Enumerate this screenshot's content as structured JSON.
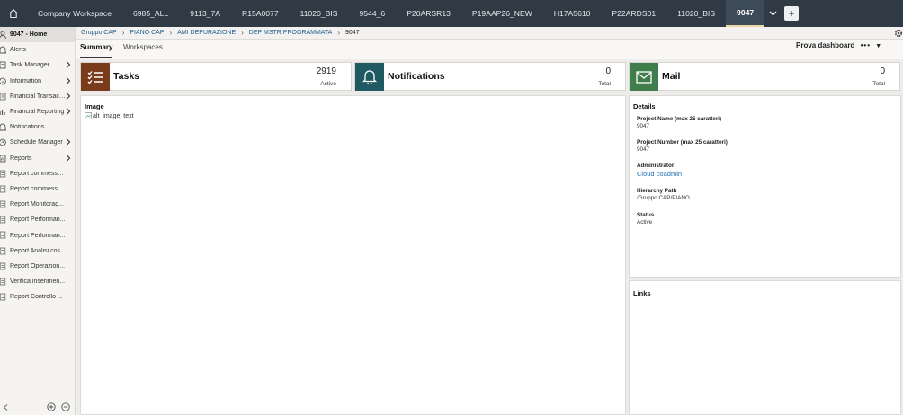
{
  "topbar": {
    "tabs": [
      "Company Workspace",
      "6985_ALL",
      "9113_7A",
      "R15A0077",
      "11020_BIS",
      "9544_6",
      "P20ARSR13",
      "P19AAP26_NEW",
      "H17A5610",
      "P22ARDS01",
      "11020_BIS",
      "9047"
    ],
    "add_label": "+"
  },
  "sidebar": {
    "items": [
      {
        "label": "9047 - Home",
        "chevron": false
      },
      {
        "label": "Alerts",
        "chevron": false
      },
      {
        "label": "Task Manager",
        "chevron": true
      },
      {
        "label": "Information",
        "chevron": true
      },
      {
        "label": "Financial Transacti...",
        "chevron": true
      },
      {
        "label": "Financial Reporting",
        "chevron": true
      },
      {
        "label": "Notifications",
        "chevron": false
      },
      {
        "label": "Schedule Manager",
        "chevron": true
      },
      {
        "label": "Reports",
        "chevron": true
      },
      {
        "label": "Report commesse...",
        "chevron": false
      },
      {
        "label": "Report commesse...",
        "chevron": false
      },
      {
        "label": "Report Monitorag...",
        "chevron": false
      },
      {
        "label": "Report Performan...",
        "chevron": false
      },
      {
        "label": "Report Performan...",
        "chevron": false
      },
      {
        "label": "Report Analisi cos...",
        "chevron": false
      },
      {
        "label": "Report Operazion...",
        "chevron": false
      },
      {
        "label": "Verifica inserimen...",
        "chevron": false
      },
      {
        "label": "Report Controllo ...",
        "chevron": false
      }
    ]
  },
  "breadcrumb": {
    "items": [
      "Gruppo CAP",
      "PIANO CAP",
      "AMI DEPURAZIONE",
      "DEP MSTR PROGRAMMATA"
    ],
    "current": "9047"
  },
  "subtabs": {
    "summary": "Summary",
    "workspaces": "Workspaces",
    "dashboard_label": "Prova dashboard"
  },
  "cards": {
    "tasks": {
      "title": "Tasks",
      "count": "2919",
      "sub": "Active",
      "color": "#7a3b1d"
    },
    "notifications": {
      "title": "Notifications",
      "count": "0",
      "sub": "Total",
      "color": "#1f5a63"
    },
    "mail": {
      "title": "Mail",
      "count": "0",
      "sub": "Total",
      "color": "#3f7d4a"
    }
  },
  "image_panel": {
    "title": "Image",
    "alt": "alt_image_text"
  },
  "details": {
    "title": "Details",
    "project_name_label": "Project Name (max 25 caratteri)",
    "project_name": "9047",
    "project_number_label": "Project Number (max 25 caratteri)",
    "project_number": "9047",
    "administrator_label": "Administrator",
    "administrator": "Cloud coadmin",
    "hierarchy_label": "Hierarchy Path",
    "hierarchy": "/Gruppo CAP/PIANO ...",
    "status_label": "Status",
    "status": "Active"
  },
  "links": {
    "title": "Links"
  }
}
